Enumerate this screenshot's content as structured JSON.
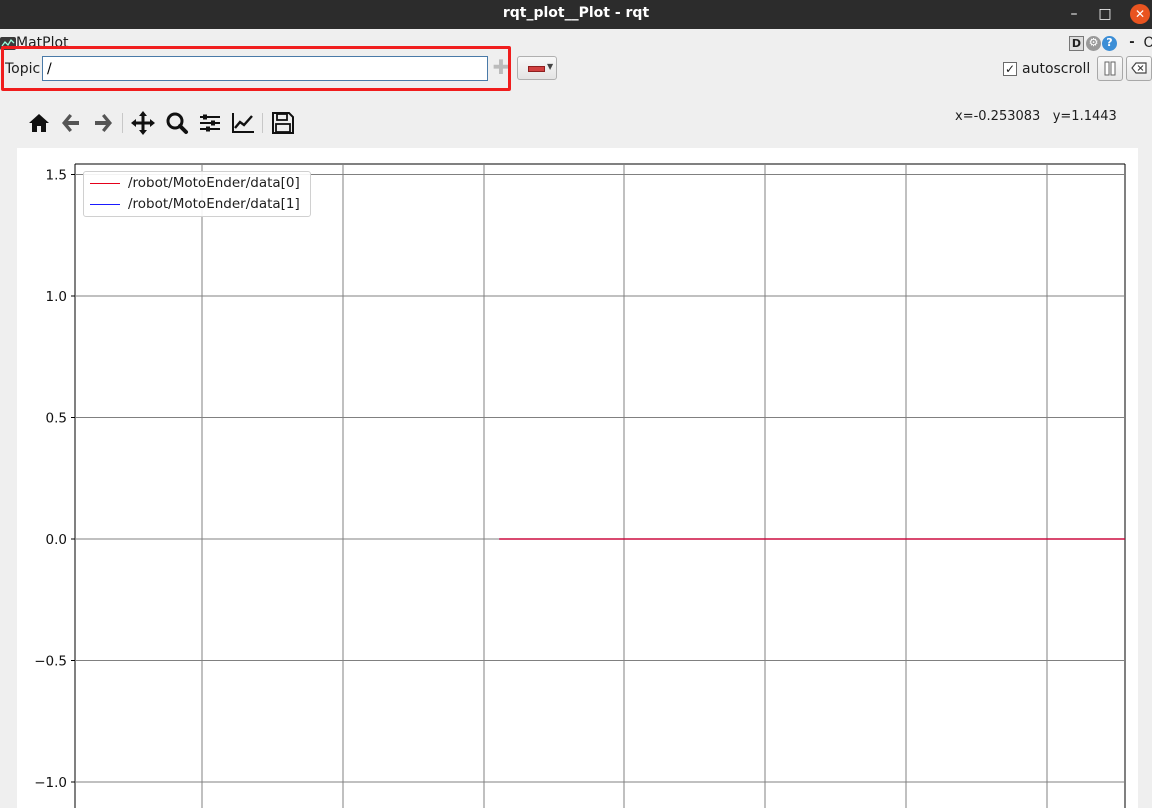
{
  "window": {
    "title": "rqt_plot__Plot - rqt"
  },
  "plugin": {
    "title": "MatPlot",
    "help_button": "D",
    "min_button": "-",
    "close_button": "O"
  },
  "topic": {
    "label": "Topic",
    "value": "/"
  },
  "autoscroll": {
    "label": "autoscroll",
    "checked": true
  },
  "toolbar": {
    "icons": [
      "home-icon",
      "back-arrow-icon",
      "forward-arrow-icon",
      "pan-icon",
      "zoom-icon",
      "configure-subplots-icon",
      "edit-axis-icon",
      "save-icon"
    ]
  },
  "coords": {
    "x": "x=-0.253083",
    "y": "y=1.1443"
  },
  "chart_data": {
    "type": "line",
    "title": "",
    "xlabel": "",
    "ylabel": "",
    "ylim": [
      -1.1,
      1.55
    ],
    "yticks": [
      "1.5",
      "1.0",
      "0.5",
      "0.0",
      "−0.5",
      "−1.0"
    ],
    "ytick_values": [
      1.5,
      1.0,
      0.5,
      0.0,
      -0.5,
      -1.0
    ],
    "grid": true,
    "legend_position": "top-left",
    "series": [
      {
        "name": "/robot/MotoEnder/data[0]",
        "color": "#e5001a",
        "x_fraction": [
          0.404,
          1.0
        ],
        "values": [
          0.0,
          0.0
        ]
      },
      {
        "name": "/robot/MotoEnder/data[1]",
        "color": "#1a1aff",
        "x_fraction": [
          0.404,
          1.0
        ],
        "values": [
          0.0,
          0.0
        ]
      }
    ]
  },
  "colors": {
    "highlight": "#f01d1d",
    "titlebar": "#2c2c2c",
    "close": "#e95420"
  }
}
